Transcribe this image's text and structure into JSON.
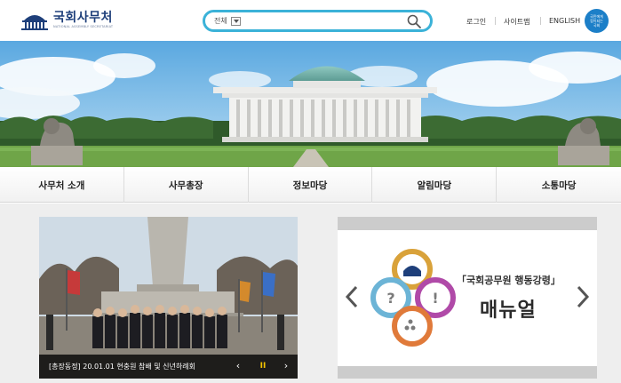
{
  "header": {
    "logo_title": "국회사무처",
    "logo_subtitle": "NATIONAL ASSEMBLY SECRETARIAT",
    "search_scope": "전체",
    "search_value": "",
    "util_links": [
      "로그인",
      "사이트맵",
      "ENGLISH"
    ],
    "badge_lines": [
      "국민에게",
      "힘이되는",
      "국회"
    ]
  },
  "nav": {
    "items": [
      "사무처 소개",
      "사무총장",
      "정보마당",
      "알림마당",
      "소통마당"
    ]
  },
  "news": {
    "caption": "[총장동정] 20.01.01 현충원 참배 및 신년하례회",
    "prev_icon": "‹",
    "pause_icon": "II",
    "next_icon": "›"
  },
  "banner": {
    "title": "「국회공무원 행동강령」",
    "big_text": "매뉴얼"
  },
  "colors": {
    "brand_navy": "#1e3f7a",
    "search_border": "#3bb2d8",
    "badge_blue": "#1c7fc8",
    "pause_yellow": "#f2c300"
  }
}
